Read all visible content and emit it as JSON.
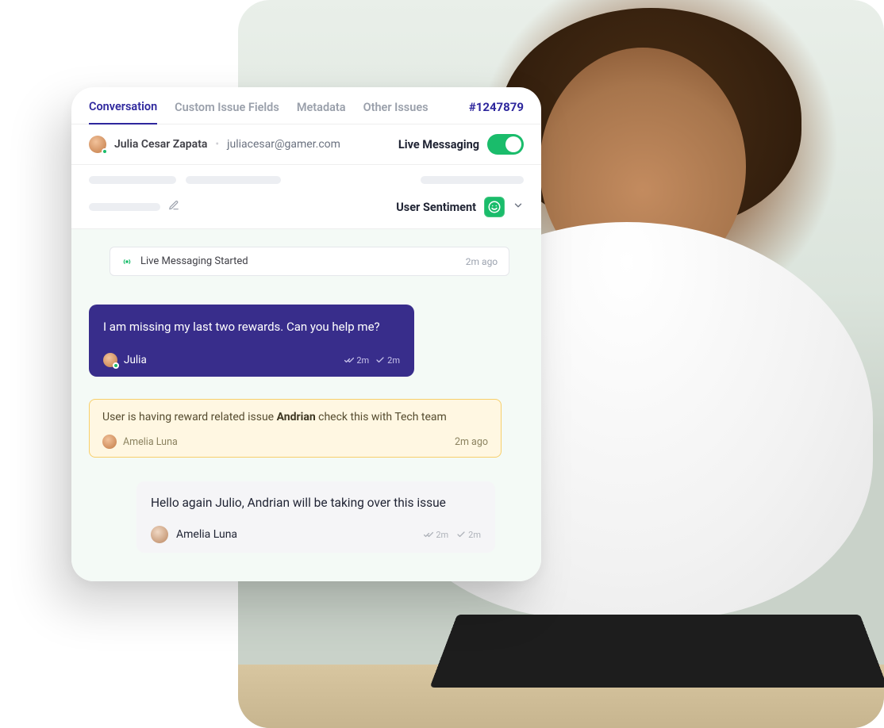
{
  "ticket_id": "#1247879",
  "tabs": {
    "conversation": "Conversation",
    "custom_issue_fields": "Custom Issue Fields",
    "metadata": "Metadata",
    "other_issues": "Other Issues"
  },
  "user": {
    "name": "Julia Cesar Zapata",
    "email": "juliacesar@gamer.com"
  },
  "live_messaging": {
    "label": "Live Messaging",
    "on": true
  },
  "sentiment": {
    "label": "User Sentiment"
  },
  "system_banner": {
    "text": "Live Messaging Started",
    "time": "2m ago"
  },
  "customer_msg": {
    "text": "I am missing my last two rewards. Can you help me?",
    "sender": "Julia",
    "tick1": "2m",
    "tick2": "2m"
  },
  "internal_note": {
    "text_before": "User is having reward related issue ",
    "mention": "Andrian",
    "text_after": " check this with Tech team",
    "author": "Amelia Luna",
    "time": "2m ago"
  },
  "agent_msg": {
    "text": "Hello again Julio, Andrian will be taking over this issue",
    "sender": "Amelia Luna",
    "tick1": "2m",
    "tick2": "2m"
  }
}
